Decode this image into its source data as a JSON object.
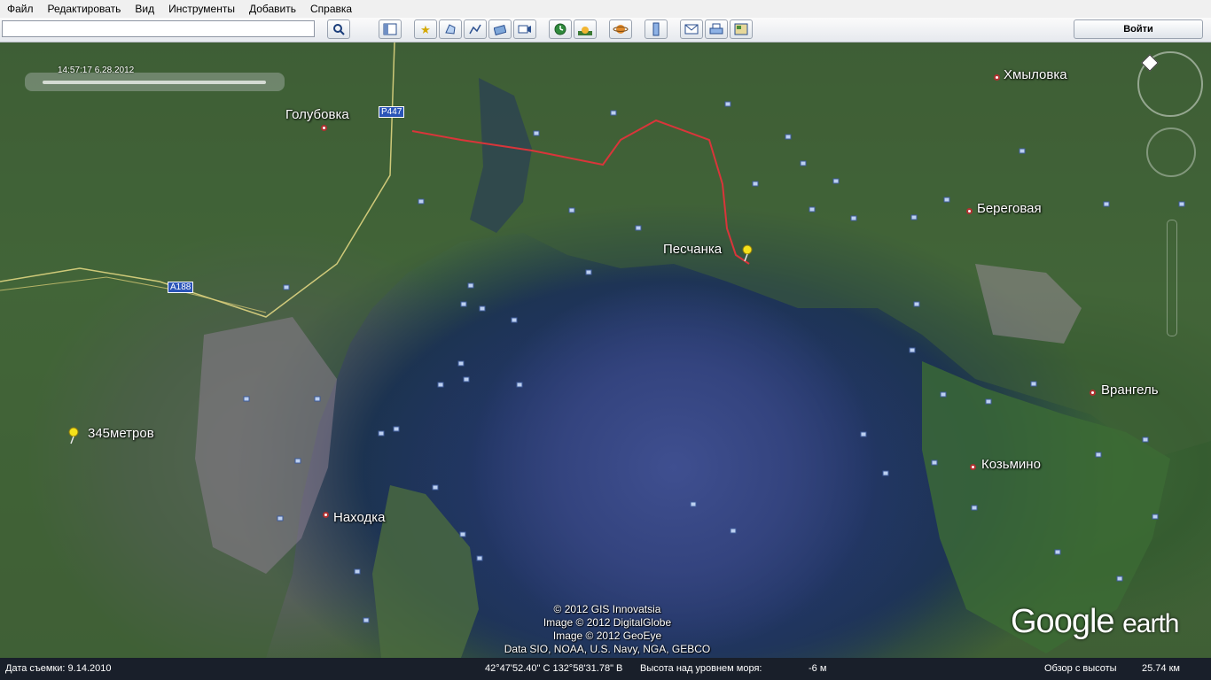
{
  "menu": {
    "file": "Файл",
    "edit": "Редактировать",
    "view": "Вид",
    "tools": "Инструменты",
    "add": "Добавить",
    "help": "Справка"
  },
  "toolbar": {
    "search_value": "",
    "login_label": "Войти",
    "icons": [
      "search-icon",
      "sidebar-toggle-icon",
      "placemark-icon",
      "polygon-icon",
      "path-icon",
      "image-overlay-icon",
      "record-tour-icon",
      "historical-imagery-icon",
      "sun-icon",
      "planets-icon",
      "ruler-icon",
      "email-icon",
      "print-icon",
      "view-in-maps-icon"
    ]
  },
  "time_slider": {
    "label": "14:57:17 6.28.2012"
  },
  "places": {
    "golubovka": "Голубовка",
    "khmylovka": "Хмыловка",
    "beregovaya": "Береговая",
    "peschanka": "Песчанка",
    "wrangel": "Врангель",
    "kozmino": "Козьмино",
    "nakhodka": "Находка",
    "placemark_345": "345метров"
  },
  "roads": {
    "r447": "Р447",
    "a188": "А188"
  },
  "credits": {
    "line1": "© 2012 GIS Innovatsia",
    "line2": "Image © 2012 DigitalGlobe",
    "line3": "Image © 2012 GeoEye",
    "line4": "Data SIO, NOAA, U.S. Navy, NGA, GEBCO"
  },
  "logo": {
    "google": "Google",
    "earth": "earth"
  },
  "status": {
    "imagery_date": "Дата съемки: 9.14.2010",
    "coords": "42°47'52.40\" С  132°58'31.78\" В",
    "elevation_label": "Высота над уровнем моря:",
    "elevation_value": "-6 м",
    "eye_alt_label": "Обзор с высоты",
    "eye_alt_value": "25.74 км"
  },
  "colors": {
    "placemark_pin": "#f5e11a",
    "route": "#d9353a",
    "road_shield": "#2b55b8"
  }
}
